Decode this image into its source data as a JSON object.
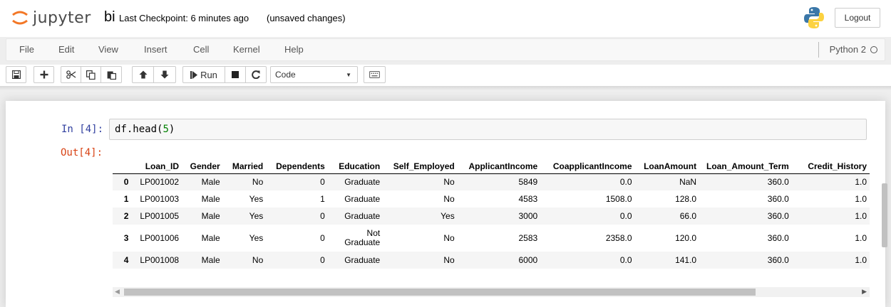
{
  "header": {
    "logo_text": "jupyter",
    "notebook_name": "bi",
    "checkpoint": "Last Checkpoint: 6 minutes ago",
    "save_status": "(unsaved changes)",
    "logout_label": "Logout"
  },
  "menu": {
    "items": [
      "File",
      "Edit",
      "View",
      "Insert",
      "Cell",
      "Kernel",
      "Help"
    ],
    "kernel_name": "Python 2"
  },
  "toolbar": {
    "run_label": "Run",
    "cell_type": "Code",
    "icons": [
      "save-icon",
      "plus-icon",
      "cut-icon",
      "copy-icon",
      "paste-icon",
      "arrow-up-icon",
      "arrow-down-icon",
      "step-forward-icon",
      "stop-icon",
      "restart-icon",
      "keyboard-icon"
    ]
  },
  "cell": {
    "in_prompt": "In [4]:",
    "code_prefix": "df.head(",
    "code_arg": "5",
    "code_suffix": ")",
    "out_prompt": "Out[4]:"
  },
  "dataframe": {
    "columns": [
      "",
      "Loan_ID",
      "Gender",
      "Married",
      "Dependents",
      "Education",
      "Self_Employed",
      "ApplicantIncome",
      "CoapplicantIncome",
      "LoanAmount",
      "Loan_Amount_Term",
      "Credit_History"
    ],
    "rows": [
      [
        "0",
        "LP001002",
        "Male",
        "No",
        "0",
        "Graduate",
        "No",
        "5849",
        "0.0",
        "NaN",
        "360.0",
        "1.0"
      ],
      [
        "1",
        "LP001003",
        "Male",
        "Yes",
        "1",
        "Graduate",
        "No",
        "4583",
        "1508.0",
        "128.0",
        "360.0",
        "1.0"
      ],
      [
        "2",
        "LP001005",
        "Male",
        "Yes",
        "0",
        "Graduate",
        "Yes",
        "3000",
        "0.0",
        "66.0",
        "360.0",
        "1.0"
      ],
      [
        "3",
        "LP001006",
        "Male",
        "Yes",
        "0",
        "Not Graduate",
        "No",
        "2583",
        "2358.0",
        "120.0",
        "360.0",
        "1.0"
      ],
      [
        "4",
        "LP001008",
        "Male",
        "No",
        "0",
        "Graduate",
        "No",
        "6000",
        "0.0",
        "141.0",
        "360.0",
        "1.0"
      ]
    ]
  }
}
